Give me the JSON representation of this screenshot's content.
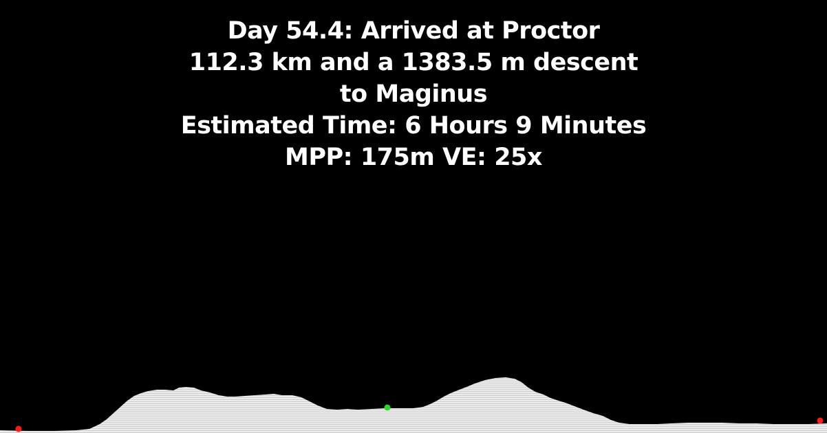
{
  "title_lines": [
    "Day 54.4: Arrived at Proctor",
    "112.3 km and a 1383.5 m descent",
    "to Maginus",
    "Estimated Time: 6 Hours 9 Minutes",
    "MPP: 175m VE: 25x"
  ],
  "colors": {
    "background": "#000000",
    "text": "#ffffff",
    "terrain": "#e6e6e6",
    "endpoint_marker": "#ff1a1a",
    "position_marker": "#22dd22"
  }
}
